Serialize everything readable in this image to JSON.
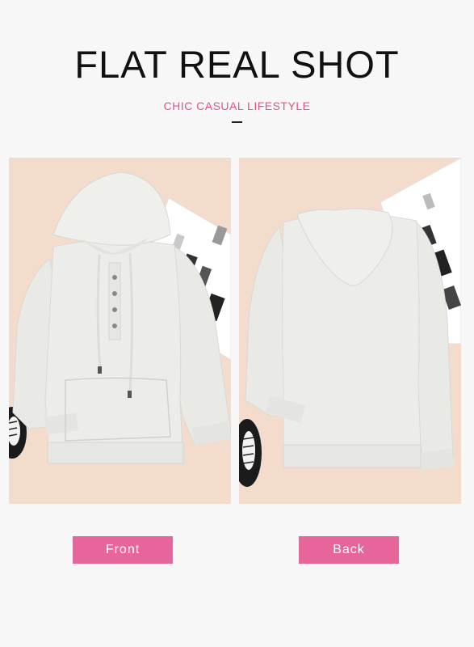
{
  "header": {
    "title": "FLAT REAL SHOT",
    "subtitle": "CHIC CASUAL LIFESTYLE"
  },
  "views": [
    {
      "label": "Front"
    },
    {
      "label": "Back"
    }
  ],
  "colors": {
    "accent": "#e6669c",
    "subtitle": "#e4508f",
    "background": "#f7f7f7",
    "photo_background": "#f3dccb",
    "garment": "#ebebe8"
  }
}
